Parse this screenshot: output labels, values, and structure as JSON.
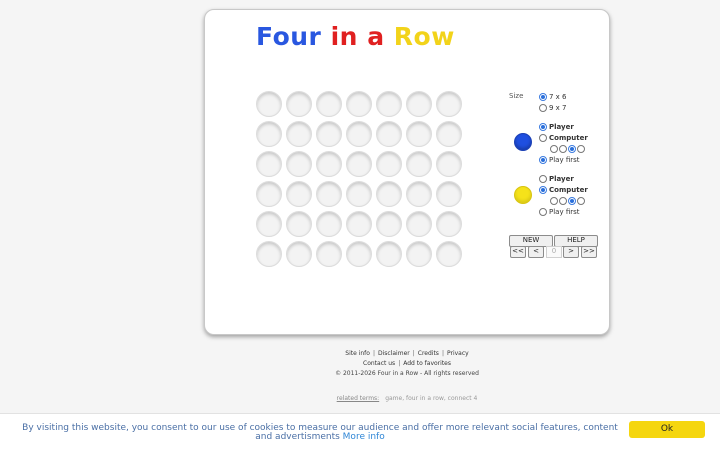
{
  "logo": {
    "words": [
      {
        "text": "Four",
        "color": "#2957e0"
      },
      {
        "text": " ",
        "color": "#ffffff"
      },
      {
        "text": "in",
        "color": "#e02020"
      },
      {
        "text": " ",
        "color": "#ffffff"
      },
      {
        "text": "a",
        "color": "#e02020"
      },
      {
        "text": " ",
        "color": "#ffffff"
      },
      {
        "text": "Row",
        "color": "#f2d31a"
      }
    ]
  },
  "board": {
    "columns": 7,
    "rows": 6,
    "cells": [
      "",
      "",
      "",
      "",
      "",
      "",
      "",
      "",
      "",
      "",
      "",
      "",
      "",
      "",
      "",
      "",
      "",
      "",
      "",
      "",
      "",
      "",
      "",
      "",
      "",
      "",
      "",
      "",
      "",
      "",
      "",
      "",
      "",
      "",
      "",
      "",
      "",
      "",
      "",
      "",
      "",
      ""
    ]
  },
  "settings": {
    "size_label": "Size",
    "size_options": [
      {
        "label": "7 x 6",
        "checked": true
      },
      {
        "label": "9 x 7",
        "checked": false
      }
    ]
  },
  "player_blue": {
    "disc_color": "#1f4fe0",
    "player_label": "Player",
    "computer_label": "Computer",
    "mode": "player",
    "levels": [
      false,
      false,
      true,
      false
    ],
    "play_first_label": "Play first",
    "play_first": true
  },
  "player_yellow": {
    "disc_color": "#f5e21a",
    "player_label": "Player",
    "computer_label": "Computer",
    "mode": "computer",
    "levels": [
      false,
      false,
      true,
      false
    ],
    "play_first_label": "Play first",
    "play_first": false
  },
  "controls": {
    "new_label": "NEW",
    "help_label": "HELP",
    "first_label": "<<",
    "prev_label": "<",
    "move_number": "0",
    "next_label": ">",
    "last_label": ">>"
  },
  "footer": {
    "line1": [
      "Site info",
      "Disclaimer",
      "Credits",
      "Privacy"
    ],
    "line2": [
      "Contact us",
      "Add to favorites"
    ],
    "copyright": "© 2011-2026 Four in a Row - All rights reserved",
    "related_label": "related terms:",
    "related_terms": "game, four in a row, connect 4"
  },
  "cookie": {
    "message": "By visiting this website, you consent to our use of cookies to measure our audience and offer more relevant social features, content and advertisments",
    "more_info": "More info",
    "ok_label": "Ok"
  },
  "colors": {
    "accent_yellow": "#f5d60f",
    "radio_blue": "#2a6fdb"
  }
}
